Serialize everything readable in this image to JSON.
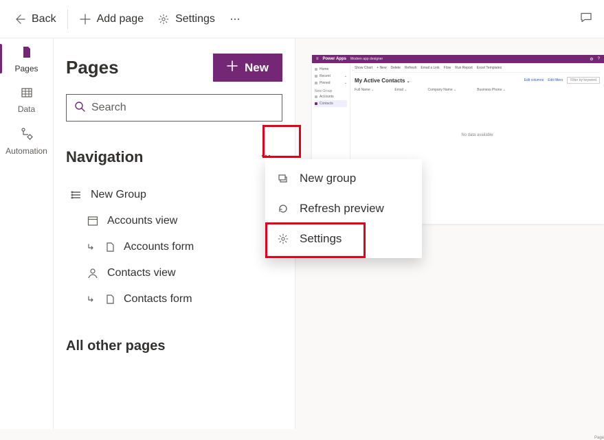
{
  "topbar": {
    "back": "Back",
    "add_page": "Add page",
    "settings": "Settings"
  },
  "rail": {
    "pages": "Pages",
    "data": "Data",
    "automation": "Automation"
  },
  "panel": {
    "title": "Pages",
    "new_btn": "New",
    "search_placeholder": "Search",
    "navigation_heading": "Navigation",
    "other_pages_heading": "All other pages",
    "tree": {
      "group": "New Group",
      "accounts_view": "Accounts view",
      "accounts_form": "Accounts form",
      "contacts_view": "Contacts view",
      "contacts_form": "Contacts form"
    }
  },
  "context_menu": {
    "new_group": "New group",
    "refresh_preview": "Refresh preview",
    "settings": "Settings"
  },
  "preview": {
    "brand": "Power Apps",
    "app_name": "Modern app designer",
    "side": {
      "home": "Home",
      "recent": "Recent",
      "pinned": "Pinned",
      "group": "New Group",
      "accounts": "Accounts",
      "contacts": "Contacts"
    },
    "cmdbar": {
      "chart": "Show Chart",
      "new": "New",
      "delete": "Delete",
      "refresh": "Refresh",
      "email": "Email a Link",
      "flow": "Flow",
      "report": "Run Report",
      "templates": "Excel Templates"
    },
    "view_title": "My Active Contacts",
    "actions": {
      "edit_columns": "Edit columns",
      "edit_filters": "Edit filters",
      "filter_placeholder": "Filter by keyword"
    },
    "columns": {
      "name": "Full Name",
      "email": "Email",
      "company": "Company Name",
      "phone": "Business Phone"
    },
    "empty": "No data available",
    "footer": "Page"
  }
}
